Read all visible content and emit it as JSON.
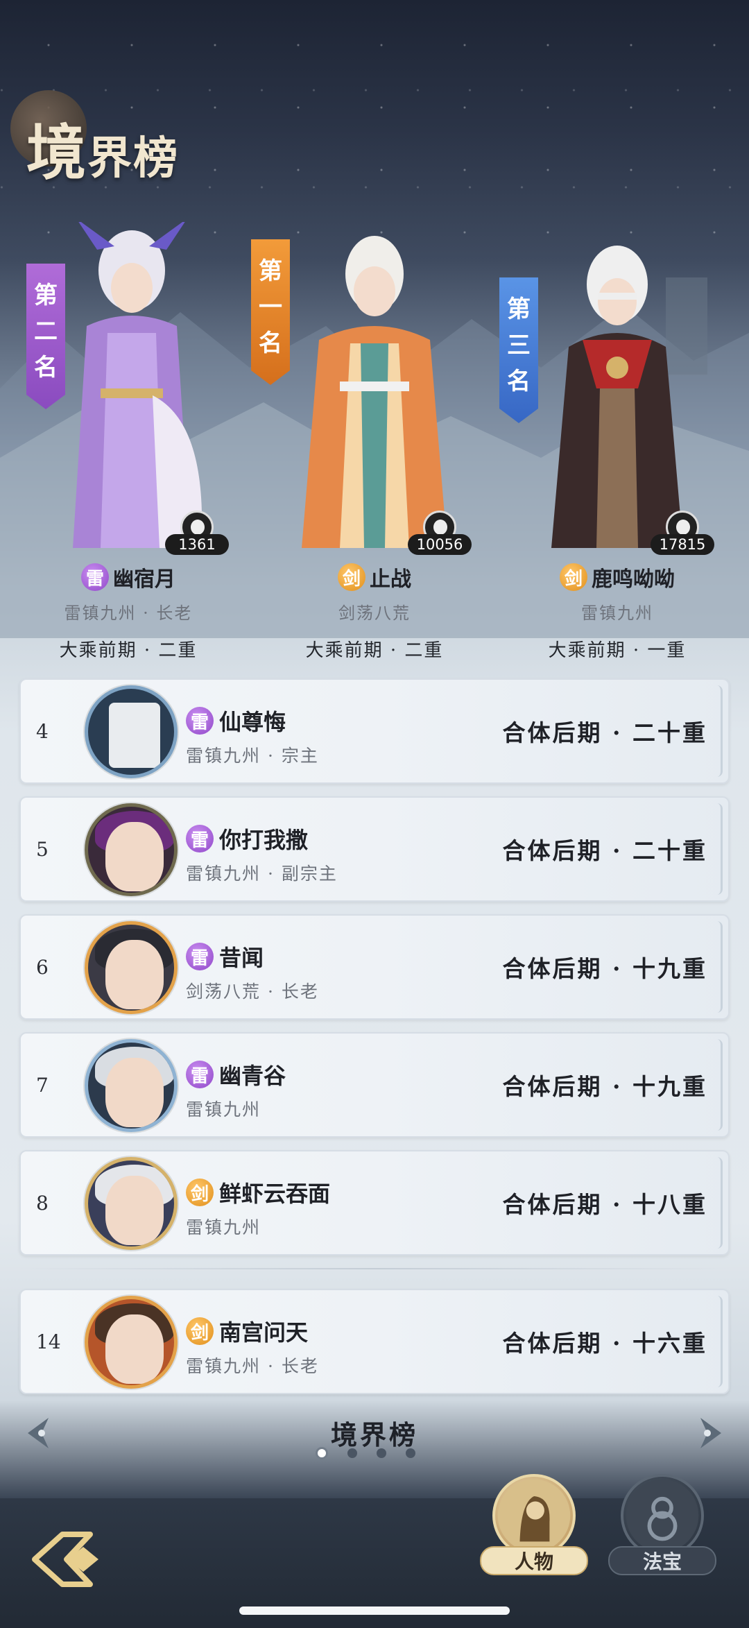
{
  "title": {
    "main": "境",
    "rest": "界榜"
  },
  "podium": [
    {
      "rank_chars": [
        "第",
        "二",
        "名"
      ],
      "score": "1361",
      "element": "雷",
      "name": "幽宿月",
      "sub": "雷镇九州 · 长老",
      "realm": "大乘前期 · 二重"
    },
    {
      "rank_chars": [
        "第",
        "一",
        "名"
      ],
      "score": "10056",
      "element": "剑",
      "name": "止战",
      "sub": "剑荡八荒",
      "realm": "大乘前期 · 二重"
    },
    {
      "rank_chars": [
        "第",
        "三",
        "名"
      ],
      "score": "17815",
      "element": "剑",
      "name": "鹿鸣呦呦",
      "sub": "雷镇九州",
      "realm": "大乘前期 · 一重"
    }
  ],
  "list": [
    {
      "rank": "4",
      "element": "雷",
      "name": "仙尊悔",
      "sub": "雷镇九州 · 宗主",
      "realm": "合体后期 · 二十重"
    },
    {
      "rank": "5",
      "element": "雷",
      "name": "你打我撒",
      "sub": "雷镇九州 · 副宗主",
      "realm": "合体后期 · 二十重"
    },
    {
      "rank": "6",
      "element": "雷",
      "name": "昔闻",
      "sub": "剑荡八荒 · 长老",
      "realm": "合体后期 · 十九重"
    },
    {
      "rank": "7",
      "element": "雷",
      "name": "幽青谷",
      "sub": "雷镇九州",
      "realm": "合体后期 · 十九重"
    },
    {
      "rank": "8",
      "element": "剑",
      "name": "鲜虾云吞面",
      "sub": "雷镇九州",
      "realm": "合体后期 · 十八重"
    }
  ],
  "self": {
    "rank": "14",
    "element": "剑",
    "name": "南宫问天",
    "sub": "雷镇九州 · 长老",
    "realm": "合体后期 · 十六重"
  },
  "pager": {
    "label": "境界榜",
    "pages": 4,
    "active": 1
  },
  "bottom_tabs": {
    "people": "人物",
    "treasure": "法宝"
  },
  "colors": {
    "thunder": "#9047c9",
    "sword": "#e08f1b",
    "rank1": "#d56f1c",
    "rank2": "#8a4bbf",
    "rank3": "#3767c4"
  }
}
